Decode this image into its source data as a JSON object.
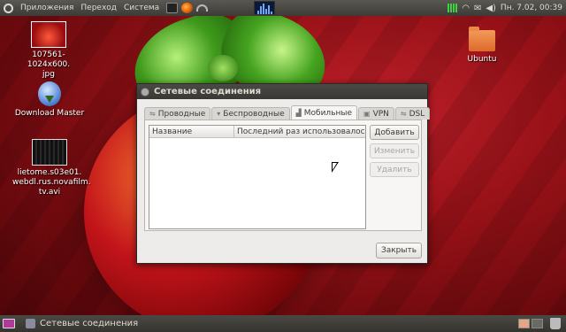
{
  "top_panel": {
    "menu": [
      "Приложения",
      "Переход",
      "Система"
    ],
    "clock": "Пн.  7.02, 00:39"
  },
  "desktop": {
    "icons": [
      {
        "label": "107561-1024x600.jpg",
        "label_l1": "107561-1024x600.",
        "label_l2": "jpg"
      },
      {
        "label": "Download Master"
      },
      {
        "label": "lietome.s03e01.webdl.rus.novafilm.tv.avi",
        "label_l1": "lietome.s03e01.",
        "label_l2": "webdl.rus.novafilm.",
        "label_l3": "tv.avi"
      },
      {
        "label": "Ubuntu"
      }
    ]
  },
  "dialog": {
    "title": "Сетевые соединения",
    "tabs": [
      {
        "label": "Проводные",
        "icon": "wired-icon"
      },
      {
        "label": "Беспроводные",
        "icon": "wireless-icon"
      },
      {
        "label": "Мобильные",
        "icon": "mobile-icon",
        "active": true
      },
      {
        "label": "VPN",
        "icon": "lock-icon"
      },
      {
        "label": "DSL",
        "icon": "dsl-icon"
      }
    ],
    "columns": [
      "Название",
      "Последний раз использовалось"
    ],
    "buttons": {
      "add": "Добавить",
      "edit": "Изменить",
      "delete": "Удалить",
      "close": "Закрыть"
    }
  },
  "bottom_panel": {
    "task_label": "Сетевые соединения"
  }
}
